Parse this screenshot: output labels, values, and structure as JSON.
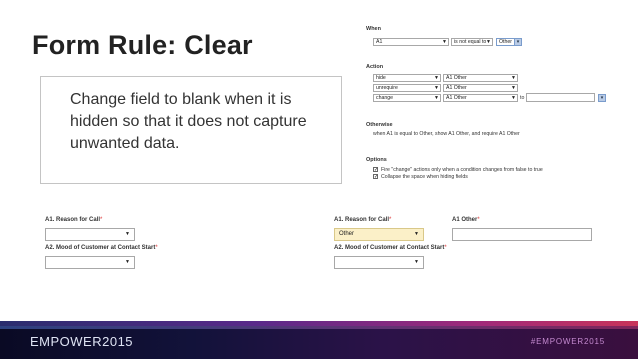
{
  "slide": {
    "title": "Form Rule: Clear",
    "bullet": "Change field to blank when it is hidden so that it does not capture unwanted data."
  },
  "rule": {
    "when_label": "When",
    "when": {
      "field": "A1",
      "operator": "is not equal to",
      "value": "Other"
    },
    "action_label": "Action",
    "actions": [
      {
        "verb": "hide",
        "target": "A1 Other"
      },
      {
        "verb": "unrequire",
        "target": "A1 Other"
      },
      {
        "verb": "change",
        "target": "A1 Other",
        "to_label": "to",
        "to_value": ""
      }
    ],
    "otherwise_label": "Otherwise",
    "otherwise_text": "when A1 is equal to Other, show A1 Other, and require A1 Other",
    "options_label": "Options",
    "options": [
      {
        "label": "Fire \"change\" actions only when a condition changes from false to true",
        "checked": true
      },
      {
        "label": "Collapse the space when hiding fields",
        "checked": true
      }
    ]
  },
  "form_left": {
    "q1_label": "A1. Reason for Call",
    "q1_value": "",
    "q2_label": "A2. Mood of Customer at Contact Start",
    "q2_value": ""
  },
  "form_right": {
    "q1_label": "A1. Reason for Call",
    "q1_value": "Other",
    "other_label": "A1 Other",
    "other_value": "",
    "q2_label": "A2. Mood of Customer at Contact Start",
    "q2_value": ""
  },
  "required_mark": "*",
  "icons": {
    "dropdown": "chevron-down-icon",
    "check": "checkbox-check-icon"
  },
  "footer": {
    "brand": "EMPOWER2015",
    "hashtag": "#EMPOWER2015"
  },
  "colors": {
    "highlight": "#fbf0c8",
    "required": "#dd3333",
    "footer_bg": "#12123a"
  }
}
